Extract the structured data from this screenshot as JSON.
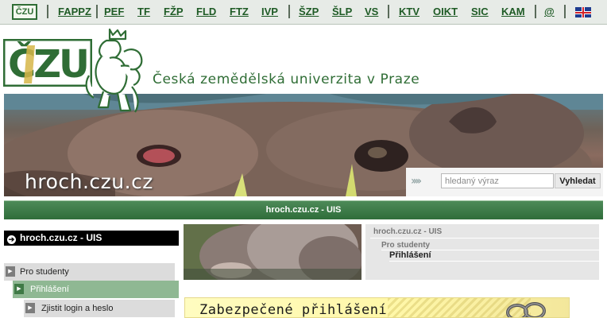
{
  "topnav": {
    "logo": "ČZU",
    "links": [
      "FAPPZ",
      "PEF",
      "TF",
      "FŽP",
      "FLD",
      "FTZ",
      "IVP",
      "ŠZP",
      "ŠLP",
      "VS",
      "KTV",
      "OIKT",
      "SIC",
      "KAM",
      "@"
    ],
    "flag_icon": "uk-flag-icon"
  },
  "header": {
    "logo_text": "ČZU",
    "university_name": "Česká zemědělská univerzita v Praze",
    "brand_color": "#2f6d35"
  },
  "banner": {
    "site_name": "hroch.czu.cz",
    "search_placeholder": "hledaný výraz",
    "search_button": "Vyhledat"
  },
  "titlebar": {
    "text": "hroch.czu.cz - UIS"
  },
  "sidebar": {
    "heading": "hroch.czu.cz - UIS",
    "items": [
      {
        "label": "Pro studenty"
      },
      {
        "label": "Přihlášení"
      },
      {
        "label": "Zjistit login a heslo"
      }
    ]
  },
  "breadcrumb": {
    "root": "hroch.czu.cz - UIS",
    "level1": "Pro studenty",
    "level2": "Přihlášení"
  },
  "secure": {
    "title": "Zabezpečené přihlášení"
  }
}
